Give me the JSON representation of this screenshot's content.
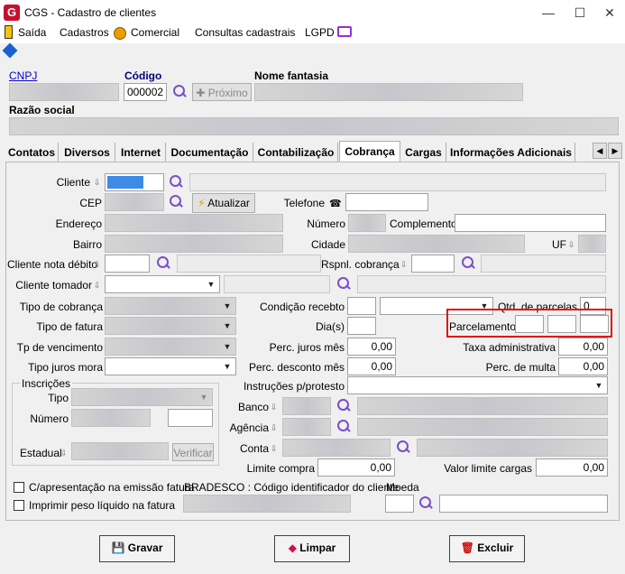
{
  "window": {
    "title": "CGS - Cadastro de clientes",
    "logo": "G",
    "minimize": "—",
    "maximize": "☐",
    "close": "✕"
  },
  "menu": {
    "saida": "Saída",
    "cadastros": "Cadastros",
    "comercial": "Comercial",
    "consultas": "Consultas cadastrais",
    "lgpd": "LGPD"
  },
  "header": {
    "cnpj_label": "CNPJ",
    "codigo_label": "Código",
    "codigo_value": "000002",
    "proximo_label": "Próximo",
    "nome_fantasia_label": "Nome fantasia",
    "razao_social_label": "Razão social"
  },
  "tabs": [
    {
      "label": "Contatos"
    },
    {
      "label": "Diversos"
    },
    {
      "label": "Internet"
    },
    {
      "label": "Documentação"
    },
    {
      "label": "Contabilização"
    },
    {
      "label": "Cobrança"
    },
    {
      "label": "Cargas"
    },
    {
      "label": "Informações Adicionais"
    }
  ],
  "tab_nav": {
    "prev": "◀",
    "next": "▶"
  },
  "form": {
    "cliente": "Cliente",
    "cep": "CEP",
    "atualizar": "Atualizar",
    "telefone": "Telefone",
    "endereco": "Endereço",
    "numero": "Número",
    "complemento": "Complemento",
    "bairro": "Bairro",
    "cidade": "Cidade",
    "uf": "UF",
    "cliente_nota_debito": "Cliente nota débito",
    "rspnl_cobranca": "Rspnl. cobrança",
    "cliente_tomador": "Cliente tomador",
    "tipo_cobranca": "Tipo de cobrança",
    "condicao_recebto": "Condição recebto",
    "qtd_parcelas": "Qtd. de parcelas",
    "qtd_parcelas_value": "0",
    "tipo_fatura": "Tipo de fatura",
    "dias": "Dia(s)",
    "parcelamento": "Parcelamento",
    "tp_vencimento": "Tp de vencimento",
    "perc_juros_mes": "Perc. juros mês",
    "perc_juros_mes_value": "0,00",
    "taxa_administrativa": "Taxa administrativa",
    "taxa_administrativa_value": "0,00",
    "tipo_juros_mora": "Tipo juros mora",
    "perc_desconto_mes": "Perc. desconto mês",
    "perc_desconto_mes_value": "0,00",
    "perc_multa": "Perc. de multa",
    "perc_multa_value": "0,00",
    "inscricoes": "Inscrições",
    "tipo": "Tipo",
    "numero_insc": "Número",
    "estadual": "Estadual",
    "verificar": "Verificar",
    "instrucoes": "Instruções p/protesto",
    "banco": "Banco",
    "agencia": "Agência",
    "conta": "Conta",
    "limite_compra": "Limite compra",
    "limite_compra_value": "0,00",
    "valor_limite_cargas": "Valor limite cargas",
    "valor_limite_cargas_value": "0,00",
    "c_apresentacao": "C/apresentação na emissão fatura",
    "bradesco": "BRADESCO : Código identificador do cliente",
    "moeda": "Moeda",
    "imprimir_peso": "Imprimir peso líquido na fatura"
  },
  "footer": {
    "gravar": "Gravar",
    "limpar": "Limpar",
    "excluir": "Excluir"
  },
  "colors": {
    "highlight": "#e01010",
    "accent": "#7b4fc8",
    "link": "#0000cc"
  }
}
